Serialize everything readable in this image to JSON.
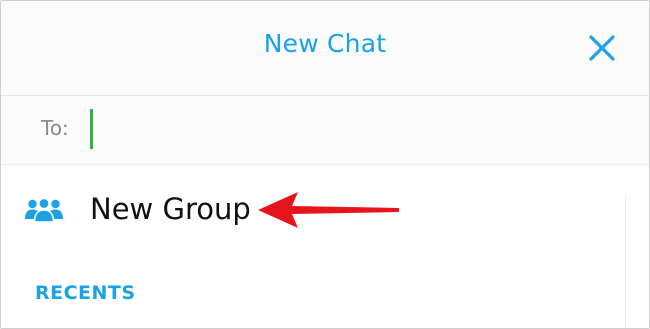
{
  "header": {
    "title": "New Chat",
    "close_icon": "close-icon"
  },
  "to_field": {
    "label": "To:",
    "value": "",
    "placeholder": ""
  },
  "new_group": {
    "label": "New Group",
    "icon": "group-icon"
  },
  "recents": {
    "heading": "RECENTS"
  },
  "colors": {
    "accent": "#1aa1e6",
    "caret": "#2fb34a",
    "arrow": "#e8141b"
  }
}
